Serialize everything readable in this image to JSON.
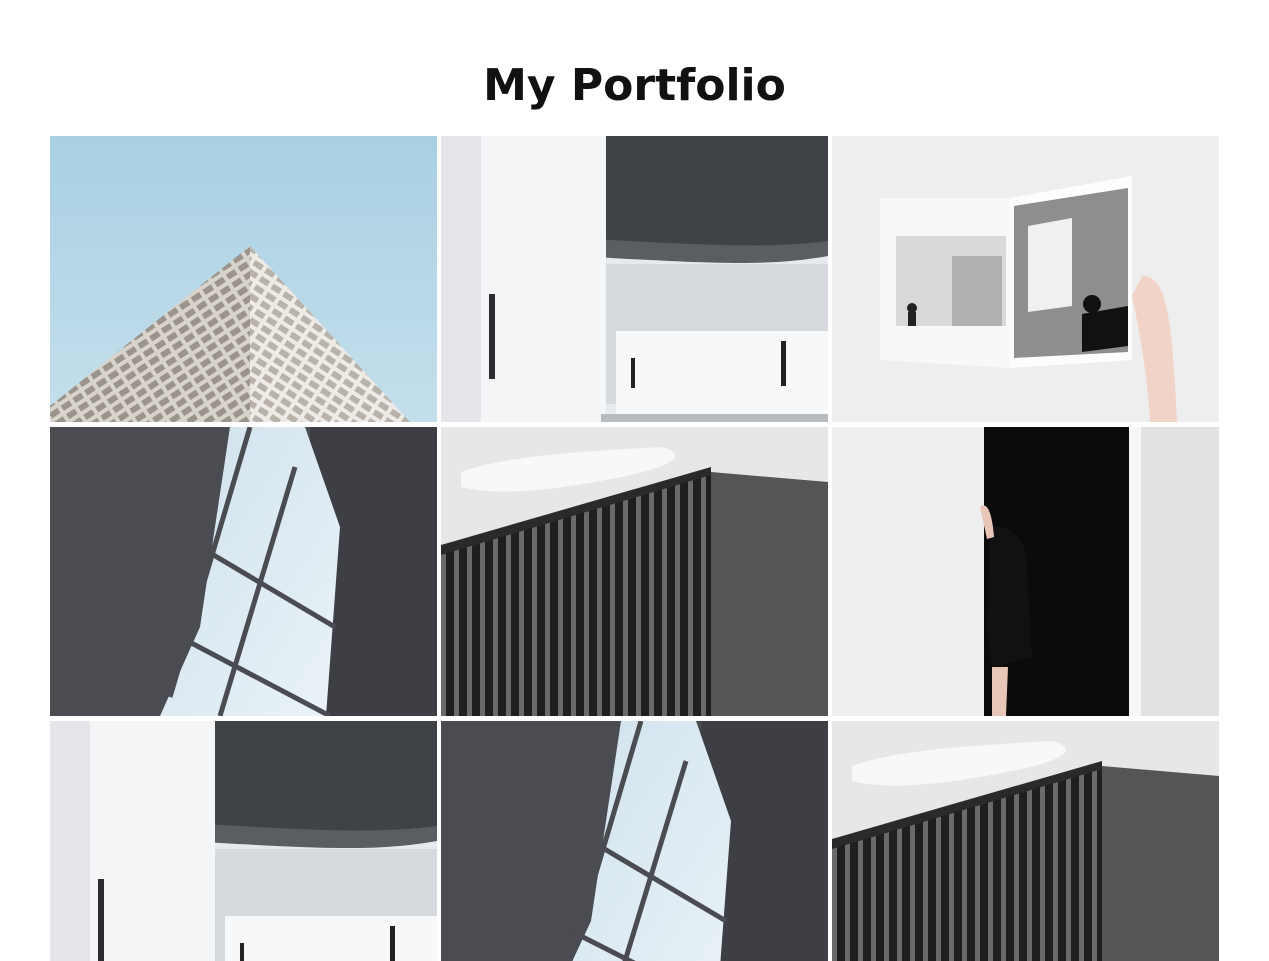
{
  "page": {
    "title": "My Portfolio"
  },
  "gallery": {
    "items": [
      {
        "name": "pyramid-facade-photo"
      },
      {
        "name": "museum-canopy-photo"
      },
      {
        "name": "open-magazine-photo"
      },
      {
        "name": "skylight-wedge-photo"
      },
      {
        "name": "slatted-building-photo"
      },
      {
        "name": "woman-in-doorway-photo"
      },
      {
        "name": "museum-canopy-photo"
      },
      {
        "name": "skylight-wedge-photo"
      },
      {
        "name": "slatted-building-photo"
      }
    ]
  }
}
